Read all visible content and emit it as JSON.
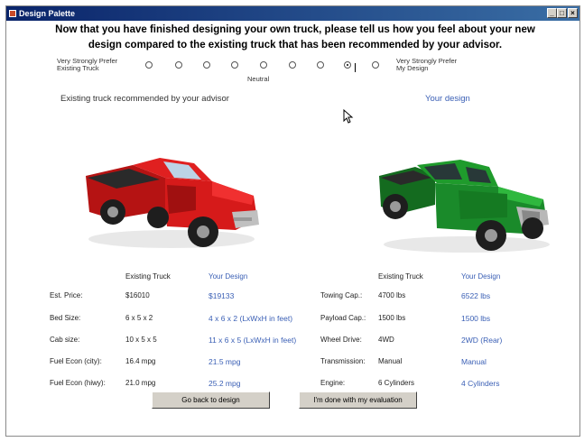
{
  "window": {
    "title": "Design Palette"
  },
  "headline": {
    "line1": "Now that you have finished designing your own truck, please tell us how you feel about your new",
    "line2": "design compared to the existing truck that has been recommended by your advisor."
  },
  "scale": {
    "left_label_1": "Very Strongly Prefer",
    "left_label_2": "Existing Truck",
    "right_label_1": "Very Strongly Prefer",
    "right_label_2": "My Design",
    "neutral_label": "Neutral",
    "selected_index": 8,
    "option_count": 9
  },
  "existing_heading": "Existing truck recommended by your advisor",
  "design_heading": "Your design",
  "colors": {
    "accent_blue": "#3a5fb5",
    "existing_truck": "#d61a1a",
    "design_truck": "#1a8a2a"
  },
  "table_headers": {
    "left_existing": "Existing Truck",
    "left_design": "Your Design",
    "right_existing": "Existing Truck",
    "right_design": "Your Design"
  },
  "left_rows": [
    {
      "label": "Est. Price:",
      "existing": "$16010",
      "design": "$19133"
    },
    {
      "label": "Bed Size:",
      "existing": "6 x 5 x 2",
      "design": "4 x 6 x 2 (LxWxH in feet)"
    },
    {
      "label": "Cab size:",
      "existing": "10 x 5 x 5",
      "design": "11 x 6 x 5 (LxWxH in feet)"
    },
    {
      "label": "Fuel Econ (city):",
      "existing": "16.4 mpg",
      "design": "21.5 mpg"
    },
    {
      "label": "Fuel Econ (hiwy):",
      "existing": "21.0 mpg",
      "design": "25.2 mpg"
    }
  ],
  "right_rows": [
    {
      "label": "Towing Cap.:",
      "existing": "4700 lbs",
      "design": "6522 lbs"
    },
    {
      "label": "Payload Cap.:",
      "existing": "1500 lbs",
      "design": "1500 lbs"
    },
    {
      "label": "Wheel Drive:",
      "existing": "4WD",
      "design": "2WD (Rear)"
    },
    {
      "label": "Transmission:",
      "existing": "Manual",
      "design": "Manual"
    },
    {
      "label": "Engine:",
      "existing": "6 Cylinders",
      "design": "4 Cylinders"
    }
  ],
  "buttons": {
    "back": "Go back to design",
    "done": "I'm done with my evaluation"
  }
}
